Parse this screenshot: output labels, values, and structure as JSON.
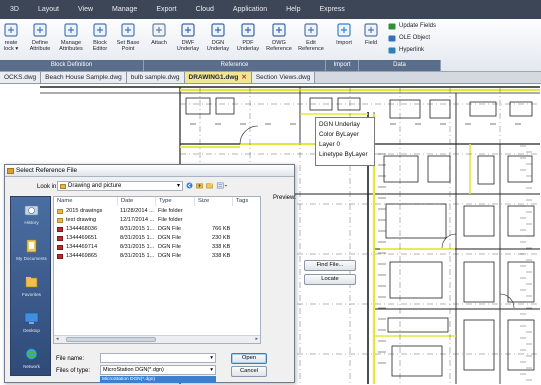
{
  "menubar": {
    "items": [
      "3D",
      "Layout",
      "View",
      "Manage",
      "Export",
      "Cloud",
      "Application",
      "Help",
      "Express"
    ]
  },
  "ribbon": {
    "buttons": [
      {
        "name": "create-block",
        "label": "reate\nlock ▾",
        "icon": "create-block-icon"
      },
      {
        "name": "define-attribute",
        "label": "Define\nAttribute",
        "icon": "define-attribute-icon"
      },
      {
        "name": "manage-attributes",
        "label": "Manage\nAttributes",
        "icon": "manage-attributes-icon"
      },
      {
        "name": "block-editor",
        "label": "Block\nEditor",
        "icon": "block-editor-icon"
      },
      {
        "name": "set-base-point",
        "label": "Set Base\nPoint",
        "icon": "set-base-point-icon"
      },
      {
        "name": "attach",
        "label": "Attach",
        "icon": "attach-icon"
      },
      {
        "name": "dwf-underlay",
        "label": "DWF\nUnderlay",
        "icon": "dwf-underlay-icon"
      },
      {
        "name": "dgn-underlay",
        "label": "DGN\nUnderlay",
        "icon": "dgn-underlay-icon"
      },
      {
        "name": "pdf-underlay",
        "label": "PDF\nUnderlay",
        "icon": "pdf-underlay-icon"
      },
      {
        "name": "dwg-reference",
        "label": "DWG\nReference",
        "icon": "dwg-reference-icon"
      },
      {
        "name": "edit-reference",
        "label": "Edit\nReference",
        "icon": "edit-reference-icon"
      },
      {
        "name": "import",
        "label": "Import",
        "icon": "import-icon"
      },
      {
        "name": "field",
        "label": "Field",
        "icon": "field-icon"
      }
    ],
    "small_buttons": [
      {
        "name": "update-fields",
        "label": "Update Fields",
        "icon": "update-fields-icon"
      },
      {
        "name": "ole-object",
        "label": "OLE Object",
        "icon": "ole-object-icon"
      },
      {
        "name": "hyperlink",
        "label": "Hyperlink",
        "icon": "hyperlink-icon"
      }
    ],
    "groups": [
      "Block Definition",
      "Reference",
      "Import",
      "Data"
    ]
  },
  "tabs": [
    {
      "label": "OCKS.dwg",
      "active": false,
      "closable": false
    },
    {
      "label": "Beach House Sample.dwg",
      "active": false,
      "closable": false
    },
    {
      "label": "bulb sample.dwg",
      "active": false,
      "closable": false
    },
    {
      "label": "DRAWING1.dwg",
      "active": true,
      "closable": true
    },
    {
      "label": "Section Views.dwg",
      "active": false,
      "closable": false
    }
  ],
  "tab_close_glyph": "✕",
  "tooltip": {
    "lines": [
      "DGN Underlay",
      "Color  ByLayer",
      "Layer  0",
      "Linetype  ByLayer"
    ]
  },
  "dialog": {
    "title": "Select Reference File",
    "look_in_label": "Look in:",
    "look_in_value": "Drawing and picture",
    "places": [
      "History",
      "My Documents",
      "Favorites",
      "Desktop",
      "Network"
    ],
    "columns": [
      "Name",
      "Date",
      "Type",
      "Size",
      "Tags"
    ],
    "files": [
      {
        "name": "2015 drawings",
        "date": "11/28/2014 ...",
        "type": "File folder",
        "size": "",
        "kind": "folder"
      },
      {
        "name": "test drawing",
        "date": "12/17/2014 ...",
        "type": "File folder",
        "size": "",
        "kind": "folder"
      },
      {
        "name": "1344468036",
        "date": "8/31/2015 1...",
        "type": "DGN File",
        "size": "766 KB",
        "kind": "dgn"
      },
      {
        "name": "1344469651",
        "date": "8/31/2015 1...",
        "type": "DGN File",
        "size": "230 KB",
        "kind": "dgn"
      },
      {
        "name": "1344469714",
        "date": "8/31/2015 1...",
        "type": "DGN File",
        "size": "338 KB",
        "kind": "dgn"
      },
      {
        "name": "1344469865",
        "date": "8/31/2015 1...",
        "type": "DGN File",
        "size": "338 KB",
        "kind": "dgn"
      }
    ],
    "preview_label": "Preview:",
    "find_file_label": "Find File...",
    "locate_label": "Locate",
    "file_name_label": "File name:",
    "file_name_value": "",
    "files_of_type_label": "Files of type:",
    "files_of_type_value": "MicroStation DGN(*.dgn)",
    "files_of_type_option": "MicroStation DGN(*.dgn)",
    "open_label": "Open",
    "cancel_label": "Cancel",
    "scroll_left": "◂",
    "scroll_right": "▸"
  },
  "colors": {
    "menubar": "#3d4657",
    "active_tab": "#f1e596",
    "highlight_lines": "#e2e83a",
    "places_bar": "#3d5c8c",
    "dgn_icon": "#b92b2b"
  }
}
